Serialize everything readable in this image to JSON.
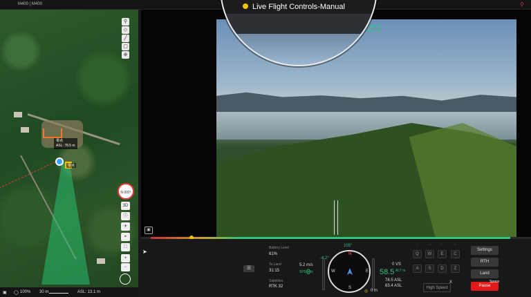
{
  "app": {
    "title": "M400 | M400"
  },
  "map": {
    "drone_label_line1": "零点",
    "drone_label_line2": "ASL: 78.5 m",
    "home_label": "零点",
    "compass_label": "N 000°",
    "controls": [
      "3D",
      "ⓘ",
      "✈",
      "⌖",
      "⛶",
      "+",
      "−"
    ],
    "tools": [
      "⚲",
      "◇",
      "╱",
      "▢",
      "⊕"
    ],
    "status": {
      "zoom": "100%",
      "scale": "30 m",
      "asl": "ASL: 13.1 m"
    }
  },
  "video": {
    "hud_tag": "0.0x",
    "mode_title": "Live Flight Controls-Manual"
  },
  "telemetry": {
    "battery_label": "Battery Level",
    "battery_value": "61%",
    "toland_label": "To Land",
    "toland_value": "31:15",
    "satellites_label": "Satellites",
    "satellites_value": "RTK 32",
    "heading": "105°",
    "pitch": "-4.2°",
    "hspeed": "5.2 m/s",
    "spd": "0",
    "spd_unit": "SPD m/s",
    "vs": "0 VS",
    "alt": "58.5",
    "alt_unit": "ALT m",
    "asl": "78.5 ASL",
    "asl2": "63.4 ASL",
    "dist": "0 m"
  },
  "keys": {
    "row1": [
      "Q",
      "W",
      "E",
      "C"
    ],
    "row2": [
      "A",
      "S",
      "D",
      "Z"
    ],
    "speed_mode": "High Speed",
    "speed_key": "X"
  },
  "actions": {
    "settings": "Settings",
    "rth": "RTH",
    "land": "Land",
    "pause": "Pause",
    "pause_key": "Space"
  }
}
